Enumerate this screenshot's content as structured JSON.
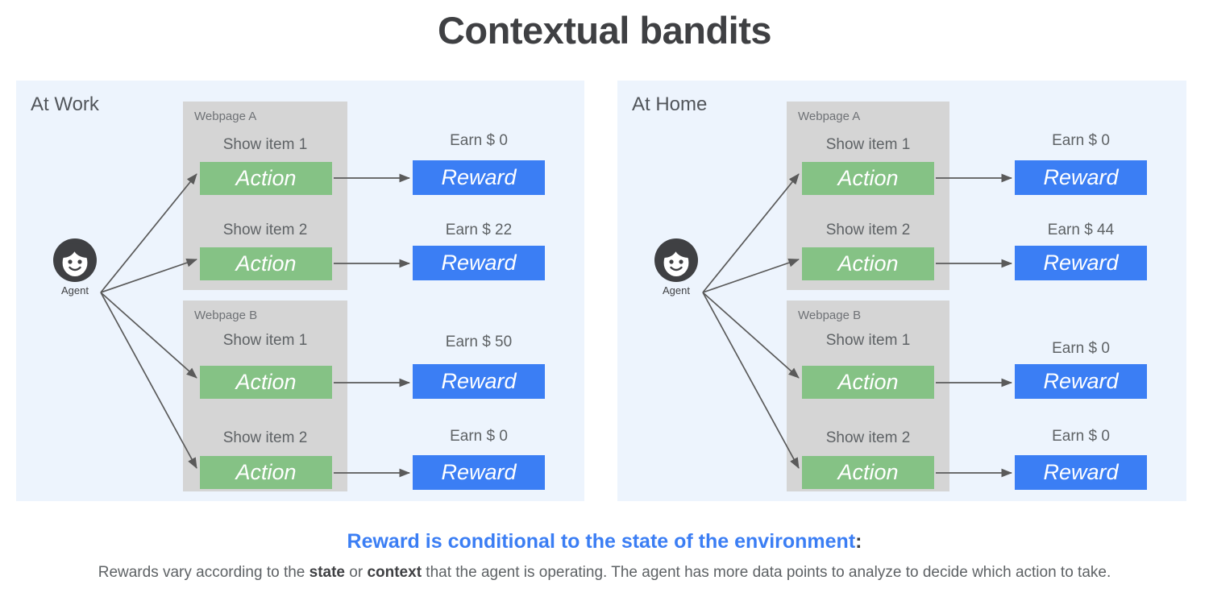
{
  "title": "Contextual bandits",
  "panels": [
    {
      "id": "work",
      "title": "At Work",
      "agent_label": "Agent",
      "webpages": [
        {
          "label": "Webpage A",
          "rows": [
            {
              "item_label": "Show item 1",
              "action_label": "Action",
              "earn_label": "Earn $ 0",
              "reward_label": "Reward",
              "reward_value": 0
            },
            {
              "item_label": "Show item 2",
              "action_label": "Action",
              "earn_label": "Earn $ 22",
              "reward_label": "Reward",
              "reward_value": 22
            }
          ]
        },
        {
          "label": "Webpage B",
          "rows": [
            {
              "item_label": "Show item 1",
              "action_label": "Action",
              "earn_label": "Earn $ 50",
              "reward_label": "Reward",
              "reward_value": 50
            },
            {
              "item_label": "Show item 2",
              "action_label": "Action",
              "earn_label": "Earn $ 0",
              "reward_label": "Reward",
              "reward_value": 0
            }
          ]
        }
      ]
    },
    {
      "id": "home",
      "title": "At Home",
      "agent_label": "Agent",
      "webpages": [
        {
          "label": "Webpage A",
          "rows": [
            {
              "item_label": "Show item 1",
              "action_label": "Action",
              "earn_label": "Earn $ 0",
              "reward_label": "Reward",
              "reward_value": 0
            },
            {
              "item_label": "Show item 2",
              "action_label": "Action",
              "earn_label": "Earn $ 44",
              "reward_label": "Reward",
              "reward_value": 44
            }
          ]
        },
        {
          "label": "Webpage B",
          "rows": [
            {
              "item_label": "Show item 1",
              "action_label": "Action",
              "earn_label": "Earn $ 0",
              "reward_label": "Reward",
              "reward_value": 0
            },
            {
              "item_label": "Show item 2",
              "action_label": "Action",
              "earn_label": "Earn $ 0",
              "reward_label": "Reward",
              "reward_value": 0
            }
          ]
        }
      ]
    }
  ],
  "caption": {
    "headline": "Reward is conditional to the state of the environment",
    "headline_tail": ":",
    "body_part1": "Rewards vary according to the ",
    "body_bold1": "state",
    "body_part2": " or ",
    "body_bold2": "context",
    "body_part3": " that the agent is operating.  The agent has more data points to analyze to decide which action to take."
  },
  "icons": {
    "agent": "agent-face-icon",
    "arrow": "arrow-head-icon"
  },
  "colors": {
    "panel_background": "#edf4fd",
    "webpage_background": "#d5d5d5",
    "action_green": "#85c285",
    "reward_blue": "#3b7ef4",
    "accent_blue": "#3b7ef4",
    "text_dark": "#3f4043",
    "text_gray": "#5e6265",
    "arrow_gray": "#5a5a5a"
  }
}
